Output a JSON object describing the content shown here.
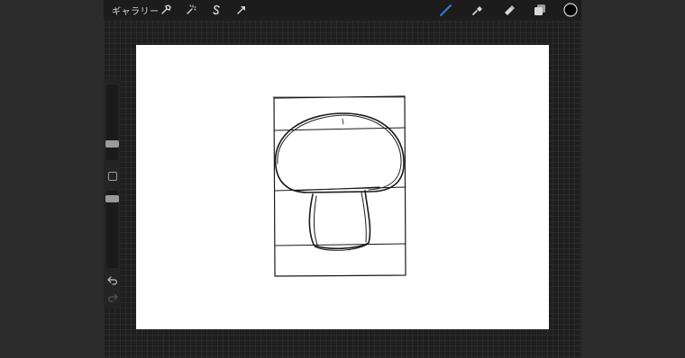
{
  "toolbar": {
    "gallery_label": "ギャラリー",
    "left_tools": [
      "wrench-icon",
      "magic-wand-icon",
      "selection-s-icon",
      "transform-arrow-icon"
    ],
    "right_tools": [
      "brush-icon",
      "smudge-icon",
      "eraser-icon",
      "layers-icon",
      "color-circle-icon"
    ],
    "active_tool": "brush-icon",
    "active_color": "#3a7bd5",
    "current_color": "#000000"
  },
  "sidebar": {
    "brush_size_level": 0.32,
    "opacity_level": 0.28,
    "controls": [
      "modify-square-button",
      "undo-icon",
      "redo-icon"
    ]
  },
  "canvas": {
    "background": "#ffffff"
  },
  "colors": {
    "app_bg": "#1f1f1f",
    "outer_bg": "#2b2b2b",
    "icon": "#d8d8d8"
  }
}
